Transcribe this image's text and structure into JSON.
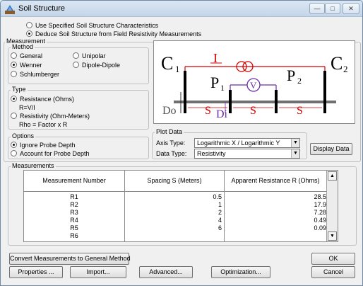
{
  "window": {
    "title": "Soil Structure",
    "controls": {
      "minimize": "—",
      "maximize": "□",
      "close": "✕"
    }
  },
  "source": {
    "options": [
      {
        "label": "Use Specified Soil Structure Characteristics",
        "selected": false
      },
      {
        "label": "Deduce Soil Structure from Field Resistivity Measurements",
        "selected": true
      }
    ]
  },
  "measurement_group": {
    "label": "Measurement"
  },
  "method": {
    "label": "Method",
    "options": [
      {
        "label": "General",
        "selected": false
      },
      {
        "label": "Unipolar",
        "selected": false
      },
      {
        "label": "Wenner",
        "selected": true
      },
      {
        "label": "Dipole-Dipole",
        "selected": false
      },
      {
        "label": "Schlumberger",
        "selected": false
      }
    ]
  },
  "type": {
    "label": "Type",
    "options": [
      {
        "label": "Resistance (Ohms)",
        "sub": "R=V/I",
        "selected": true
      },
      {
        "label": "Resistivity (Ohm-Meters)",
        "sub": "Rho = Factor x R",
        "selected": false
      }
    ]
  },
  "options": {
    "label": "Options",
    "items": [
      {
        "label": "Ignore Probe Depth",
        "selected": true
      },
      {
        "label": "Account for Probe Depth",
        "selected": false
      }
    ]
  },
  "diagram": {
    "c1": "C",
    "c1_sub": "1",
    "c2": "C",
    "c2_sub": "2",
    "p1": "P",
    "p1_sub": "1",
    "p2": "P",
    "p2_sub": "2",
    "current": "I",
    "voltmeter": "V",
    "spacing": "S",
    "depth": "Do",
    "probe_depth": "Di",
    "colors": {
      "current": "#d00000",
      "voltage": "#6a2fa0",
      "probe": "#000000",
      "ground": "#707070"
    }
  },
  "plot_data": {
    "label": "Plot Data",
    "axis_type_label": "Axis Type:",
    "axis_type_value": "Logarithmic X / Logarithmic Y",
    "data_type_label": "Data Type:",
    "data_type_value": "Resistivity",
    "display_button": "Display Data"
  },
  "measurements": {
    "label": "Measurements",
    "columns": [
      "Measurement Number",
      "Spacing S (Meters)",
      "Apparent Resistance R (Ohms)"
    ],
    "rows": [
      [
        "R1",
        "0.5",
        "28.5"
      ],
      [
        "R2",
        "1",
        "17.9"
      ],
      [
        "R3",
        "2",
        "7.28"
      ],
      [
        "R4",
        "4",
        "0.49"
      ],
      [
        "R5",
        "6",
        "0.09"
      ],
      [
        "R6",
        "",
        ""
      ]
    ]
  },
  "buttons": {
    "convert": "Convert Measurements to General Method",
    "properties": "Properties ...",
    "import": "Import...",
    "advanced": "Advanced...",
    "optimization": "Optimization...",
    "ok": "OK",
    "cancel": "Cancel"
  }
}
